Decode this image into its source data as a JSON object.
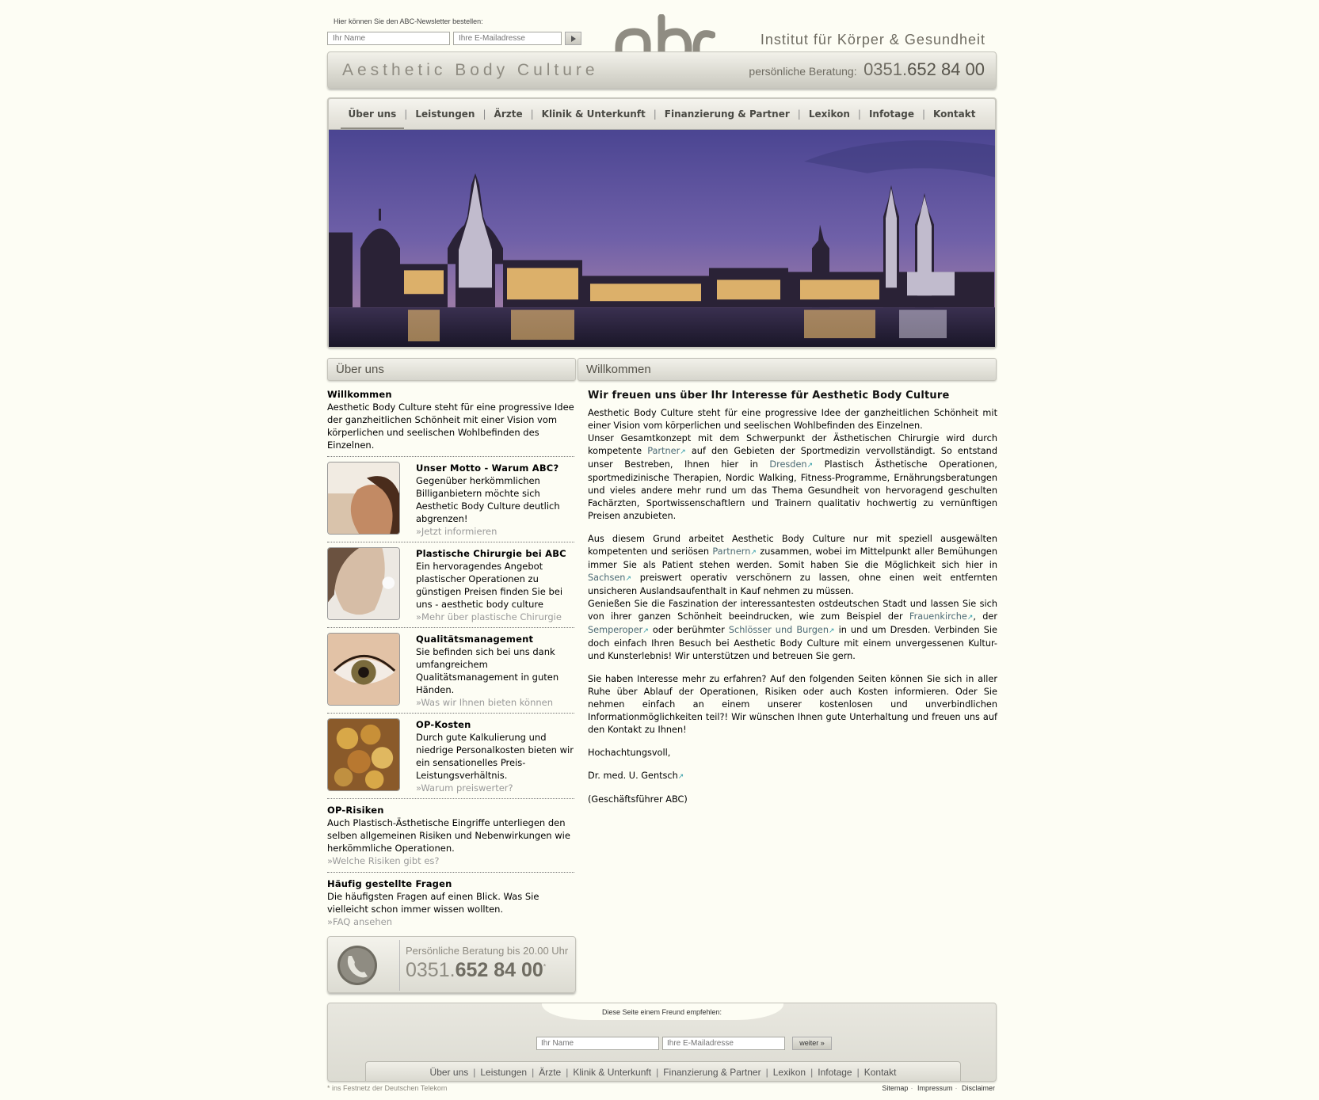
{
  "header": {
    "newsletter_label": "Hier können Sie den ABC-Newsletter bestellen:",
    "name_placeholder": "Ihr Name",
    "email_placeholder": "Ihre E-Mailadresse",
    "logo_text": "abc",
    "tagline": "Institut für Körper & Gesundheit",
    "brand": "Aesthetic Body Culture",
    "phone_label": "persönliche Beratung:",
    "phone_prefix": "0351.",
    "phone_number": "652 84 00"
  },
  "nav": {
    "items": [
      "Über uns",
      "Leistungen",
      "Ärzte",
      "Klinik & Unterkunft",
      "Finanzierung & Partner",
      "Lexikon",
      "Infotage",
      "Kontakt"
    ],
    "separator": "|",
    "active_index": 0
  },
  "left": {
    "heading": "Über uns",
    "welcome_title": "Willkommen",
    "welcome_text": "Aesthetic Body Culture steht für eine progressive Idee der ganzheitlichen Schönheit mit einer Vision vom körperlichen und seelischen Wohlbefinden des Einzelnen.",
    "items": [
      {
        "title": "Unser Motto - Warum ABC?",
        "text": "Gegenüber herkömmlichen Billiganbietern möchte sich Aesthetic Body Culture deutlich abgrenzen!",
        "more": "»Jetzt informieren"
      },
      {
        "title": "Plastische Chirurgie bei ABC",
        "text": "Ein hervoragendes Angebot plastischer Operationen zu günstigen Preisen finden Sie bei uns - aesthetic body culture",
        "more": "»Mehr über plastische Chirurgie"
      },
      {
        "title": "Qualitätsmanagement",
        "text": "Sie befinden sich bei uns dank umfangreichem Qualitätsmanagement in guten Händen.",
        "more": "»Was wir Ihnen bieten können"
      },
      {
        "title": "OP-Kosten",
        "text": "Durch gute Kalkulierung und niedrige Personalkosten bieten wir ein sensationelles Preis-Leistungsverhältnis.",
        "more": "»Warum preiswerter?"
      }
    ],
    "risks_title": "OP-Risiken",
    "risks_text": "Auch Plastisch-Ästhetische Eingriffe unterliegen den selben allgemeinen Risiken und Nebenwirkungen wie herkömmliche Operationen.",
    "risks_more": "»Welche Risiken gibt es?",
    "faq_title": "Häufig gestellte Fragen",
    "faq_text": "Die häufigsten Fragen auf einen Blick. Was Sie vielleicht schon immer wissen wollten.",
    "faq_more": "»FAQ ansehen",
    "phone_box_label": "Persönliche Beratung bis 20.00 Uhr",
    "phone_box_prefix": "0351.",
    "phone_box_number": "652 84 00",
    "phone_box_star": "*"
  },
  "right": {
    "heading": "Willkommen",
    "title": "Wir freuen uns über Ihr Interesse für Aesthetic Body Culture",
    "p1a": "Aesthetic Body Culture steht für eine progressive Idee der ganzheitlichen Schönheit mit einer Vision vom körperlichen und seelischen Wohlbefinden des Einzelnen.",
    "p1b": "Unser Gesamtkonzept mit dem Schwerpunkt der Ästhetischen Chirurgie wird durch kompetente",
    "link_partner": "Partner",
    "p1c": "auf den Gebieten der Sportmedizin vervollständigt. So entstand unser Bestreben, Ihnen hier in",
    "link_dresden": "Dresden",
    "p1d": "Plastisch Ästhetische Operationen, sportmedizinische Therapien, Nordic Walking, Fitness-Programme, Ernährungsberatungen und vieles andere mehr rund um das Thema Gesundheit von hervoragend geschulten Fachärzten, Sportwissenschaftlern und Trainern qualitativ hochwertig zu vernünftigen Preisen anzubieten.",
    "p2a": "Aus diesem Grund arbeitet Aesthetic Body Culture nur mit speziell ausgewälten kompetenten und seriösen",
    "link_partnern": "Partnern",
    "p2b": "zusammen, wobei im Mittelpunkt aller Bemühungen immer Sie als Patient stehen werden. Somit haben Sie die Möglichkeit sich hier in",
    "link_sachsen": "Sachsen",
    "p2c": "preiswert operativ verschönern zu lassen, ohne einen weit entfernten unsicheren Auslandsaufenthalt in Kauf nehmen zu müssen.",
    "p2d": "Genießen Sie die Faszination der interessantesten ostdeutschen Stadt und lassen Sie sich von ihrer ganzen Schönheit beeindrucken, wie zum Beispiel der",
    "link_frauenkirche": "Frauenkirche",
    "p2e": ", der",
    "link_semperoper": "Semperoper",
    "p2f": "oder berühmter",
    "link_schloesser": "Schlösser und Burgen",
    "p2g": "in und um Dresden. Verbinden Sie doch einfach Ihren Besuch bei Aesthetic Body Culture mit einem unvergessenen Kultur- und Kunsterlebnis! Wir unterstützen und betreuen Sie gern.",
    "p3": "Sie haben Interesse mehr zu erfahren? Auf den folgenden Seiten können Sie sich in aller Ruhe über Ablauf der Operationen, Risiken oder auch Kosten informieren. Oder Sie nehmen einfach an einem unserer kostenlosen und unverbindlichen Informationmöglichkeiten teil?! Wir wünschen Ihnen gute Unterhaltung und freuen uns auf den Kontakt zu Ihnen!",
    "closing": "Hochachtungsvoll,",
    "signature": "Dr. med. U. Gentsch",
    "role": "(Geschäftsführer ABC)",
    "arrow": "↗"
  },
  "footer": {
    "recommend_label": "Diese Seite einem Freund empfehlen:",
    "name_placeholder": "Ihr Name",
    "email_placeholder": "Ihre E-Mailadresse",
    "send_label": "weiter »",
    "nav": [
      "Über uns",
      "Leistungen",
      "Ärzte",
      "Klinik & Unterkunft",
      "Finanzierung & Partner",
      "Lexikon",
      "Infotage",
      "Kontakt"
    ],
    "note": "* ins Festnetz der Deutschen Telekom",
    "links": [
      "Sitemap",
      "Impressum",
      "Disclaimer"
    ],
    "link_sep": "·"
  },
  "colors": {
    "page_bg": "#fdfdf4",
    "bar": "#dcdbd2",
    "text_muted": "#8f8c82",
    "link": "#4c6a74",
    "link_arrow": "#2e9aa6"
  }
}
